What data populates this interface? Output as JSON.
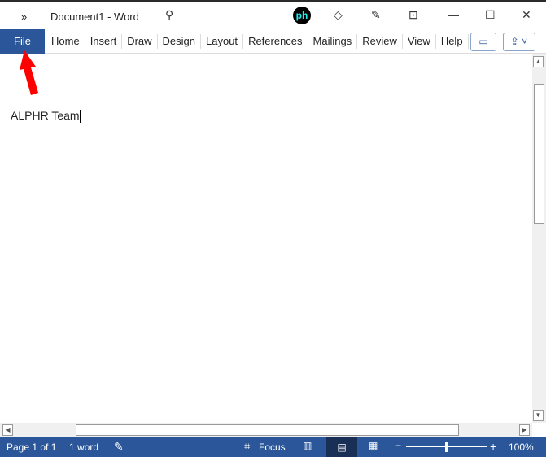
{
  "title": {
    "expand": "»",
    "doc_name": "Document1  -  Word"
  },
  "ribbon": {
    "file": "File",
    "tabs": [
      "Home",
      "Insert",
      "Draw",
      "Design",
      "Layout",
      "References",
      "Mailings",
      "Review",
      "View",
      "Help"
    ]
  },
  "document": {
    "text": "ALPHR Team"
  },
  "status": {
    "page": "Page 1 of 1",
    "words": "1 word",
    "focus": "Focus",
    "zoom": "100%",
    "zoom_fraction": 0.5
  },
  "colors": {
    "accent": "#2b579a",
    "arrow": "#ff0000"
  }
}
